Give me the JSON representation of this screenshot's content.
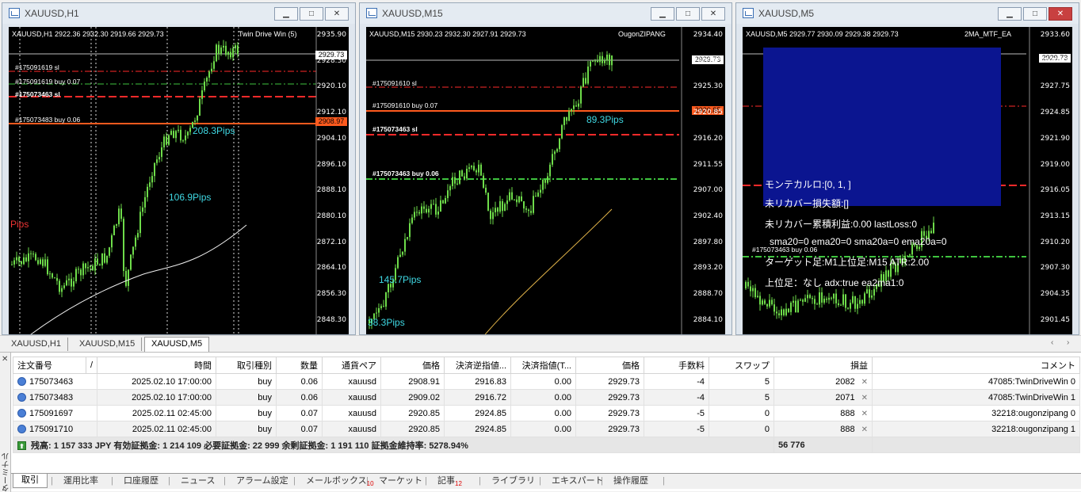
{
  "windows": [
    {
      "title": "XAUUSD,H1",
      "info": "XAUUSD,H1  2922.36 2932.30 2919.66 2929.73",
      "ea": "Twin Drive Win (5)",
      "yaxis": [
        "2935.90",
        "2928.30",
        "2920.10",
        "2912.10",
        "2904.10",
        "2896.10",
        "2888.10",
        "2880.10",
        "2872.10",
        "2864.10",
        "2856.30",
        "2848.30"
      ],
      "price_box": "2929.73",
      "order_box": "2908.97",
      "labels": [
        "#1750916​19 sl",
        "#1750916​19 buy 0.07",
        "#175073463 sl",
        "#175073483 buy 0.06"
      ],
      "pips": [
        "208.3Pips",
        "1​06.9Pips"
      ],
      "pips_red": "Pips"
    },
    {
      "title": "XAUUSD,M15",
      "info": "XAUUSD,M15  2930.23 2932.30 2927.91 2929.73",
      "ea": "OugonZIPANG",
      "yaxis": [
        "2934.40",
        "2929.85",
        "2925.30",
        "2920.85",
        "2916.20",
        "2911.55",
        "2907.00",
        "2902.40",
        "2897.80",
        "2893.20",
        "2888.70",
        "2884.10"
      ],
      "price_box": "2929.73",
      "order_box": "2920.85",
      "labels": [
        "#1750916​10 sl",
        "#1750916​10 buy 0.07",
        "#175073463 sl",
        "#175073463 buy 0.06"
      ],
      "pips": [
        "89.3Pips",
        "145.7Pips",
        "38.3Pips"
      ]
    },
    {
      "title": "XAUUSD,M5",
      "info": "XAUUSD,M5  2929.77 2930.09 2929.38 2929.73",
      "ea": "2MA_MTF_EA",
      "yaxis": [
        "2933.60",
        "2930.65",
        "2927.75",
        "2924.85",
        "2921.90",
        "2919.00",
        "2916.05",
        "2913.15",
        "2910.20",
        "2907.30",
        "2904.35",
        "2901.45"
      ],
      "price_box": "2929.73",
      "panel": [
        "モンテカルロ:[0, 1, ]",
        "未リカバー損失額:[]",
        "未リカバー累積利益:0.00 lastLoss:0",
        "sma20=0 ema20=0 sma20a=0 ema20a=0",
        "ターゲット足:M1上位足:M15 ATR:2.00",
        "上位足：なし adx:true ea2ma1:0"
      ],
      "label": "#175073463 buy 0.06"
    }
  ],
  "chart_tabs": [
    "XAUUSD,H1",
    "XAUUSD,M15",
    "XAUUSD,M5"
  ],
  "table": {
    "headers": [
      "注文番号",
      "/",
      "時間",
      "取引種別",
      "数量",
      "通貨ペア",
      "価格",
      "決済逆指値...",
      "決済指値(T...",
      "価格",
      "手数料",
      "スワップ",
      "損益",
      "コメント"
    ],
    "rows": [
      [
        "175073463",
        "2025.02.10 17:00:00",
        "buy",
        "0.06",
        "xauusd",
        "2908.91",
        "2916.83",
        "0.00",
        "2929.73",
        "-4",
        "5",
        "2082",
        "47085:TwinDriveWin 0"
      ],
      [
        "175073483",
        "2025.02.10 17:00:00",
        "buy",
        "0.06",
        "xauusd",
        "2909.02",
        "2916.72",
        "0.00",
        "2929.73",
        "-4",
        "5",
        "2071",
        "47085:TwinDriveWin 1"
      ],
      [
        "175091697",
        "2025.02.11 02:45:00",
        "buy",
        "0.07",
        "xauusd",
        "2920.85",
        "2924.85",
        "0.00",
        "2929.73",
        "-5",
        "0",
        "888",
        "32218:ougonzipang 0"
      ],
      [
        "175091710",
        "2025.02.11 02:45:00",
        "buy",
        "0.07",
        "xauusd",
        "2920.85",
        "2924.85",
        "0.00",
        "2929.73",
        "-5",
        "0",
        "888",
        "32218:ougonzipang 1"
      ]
    ],
    "balance": "残高: 1 157 333 JPY  有効証拠金: 1 214 109  必要証拠金: 22 999  余剰証拠金: 1 191 110  証拠金維持率: 5278.94%",
    "total": "56 776"
  },
  "terminal_label": "ターミナル",
  "bottom_tabs": [
    {
      "label": "取引"
    },
    {
      "label": "運用比率"
    },
    {
      "label": "口座履歴"
    },
    {
      "label": "ニュース"
    },
    {
      "label": "アラーム設定"
    },
    {
      "label": "メールボックス",
      "badge": "10"
    },
    {
      "label": "マーケット"
    },
    {
      "label": "記事",
      "badge": "12"
    },
    {
      "label": "ライブラリ"
    },
    {
      "label": "エキスパート"
    },
    {
      "label": "操作履歴"
    }
  ],
  "colors": {
    "candle": "#6edc4a",
    "sl": "#ff2a2a",
    "tp": "#3fc43f",
    "order_line": "#ff5a1e",
    "panel": "#0b1590",
    "pips": "#3fd9e4"
  }
}
